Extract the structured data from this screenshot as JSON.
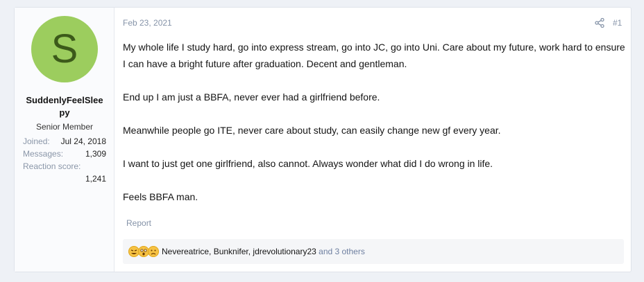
{
  "user": {
    "avatar_letter": "S",
    "avatar_color": "#9ccd5e",
    "username": "SuddenlyFeelSleepy",
    "title": "Senior Member",
    "stats": [
      {
        "label": "Joined:",
        "value": "Jul 24, 2018"
      },
      {
        "label": "Messages:",
        "value": "1,309"
      },
      {
        "label": "Reaction score:",
        "value": "1,241"
      }
    ]
  },
  "post": {
    "date": "Feb 23, 2021",
    "number": "#1",
    "paragraphs": [
      "My whole life I study hard, go into express stream, go into JC, go into Uni. Care about my future, work hard to ensure I can have a bright future after graduation. Decent and gentleman.",
      "End up I am just a BBFA, never ever had a girlfriend before.",
      "Meanwhile people go ITE, never care about study, can easily change new gf every year.",
      "I want to just get one girlfriend, also cannot. Always wonder what did I do wrong in life.",
      "Feels BBFA man."
    ],
    "report_label": "Report"
  },
  "reactions": {
    "icons": [
      "rofl-emoji",
      "astonished-emoji",
      "frown-emoji"
    ],
    "users_text": "Nevereatrice, Bunknifer, jdrevolutionary23",
    "others_text": "and 3 others"
  }
}
